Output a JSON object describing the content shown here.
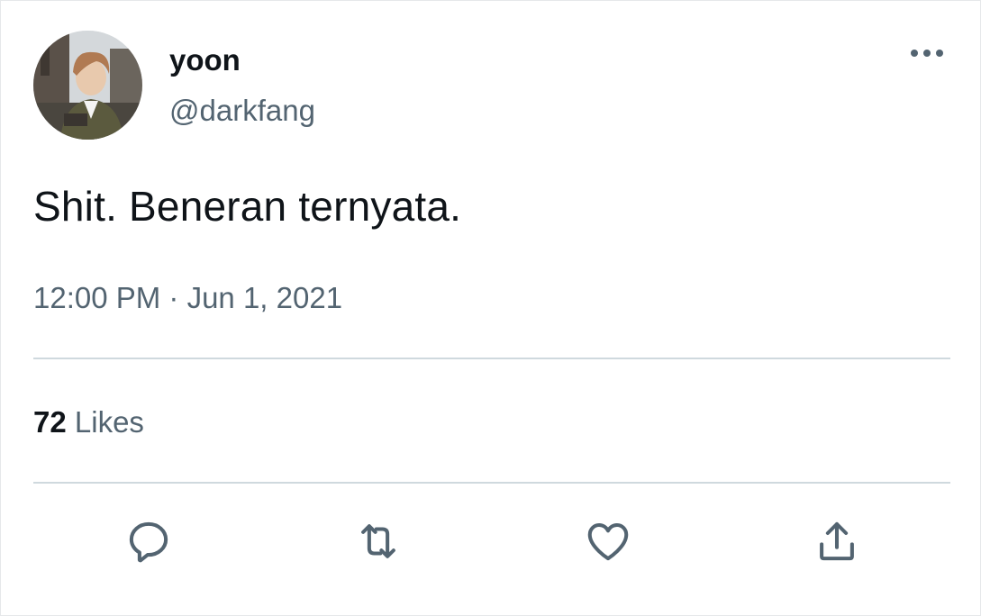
{
  "tweet": {
    "author": {
      "display_name": "yoon",
      "handle": "@darkfang",
      "avatar_icon": "profile-photo"
    },
    "text": "Shit. Beneran ternyata.",
    "timestamp": "12:00 PM · Jun 1, 2021",
    "stats": {
      "likes_count": "72",
      "likes_label": "Likes"
    },
    "actions": [
      {
        "name": "reply",
        "icon": "reply-icon"
      },
      {
        "name": "retweet",
        "icon": "retweet-icon"
      },
      {
        "name": "like",
        "icon": "heart-icon"
      },
      {
        "name": "share",
        "icon": "share-icon"
      }
    ],
    "more_icon": "more-horizontal-icon"
  },
  "colors": {
    "text_primary": "#0f1419",
    "text_secondary": "#536471",
    "divider": "#cfd9de",
    "icon": "#536471"
  }
}
